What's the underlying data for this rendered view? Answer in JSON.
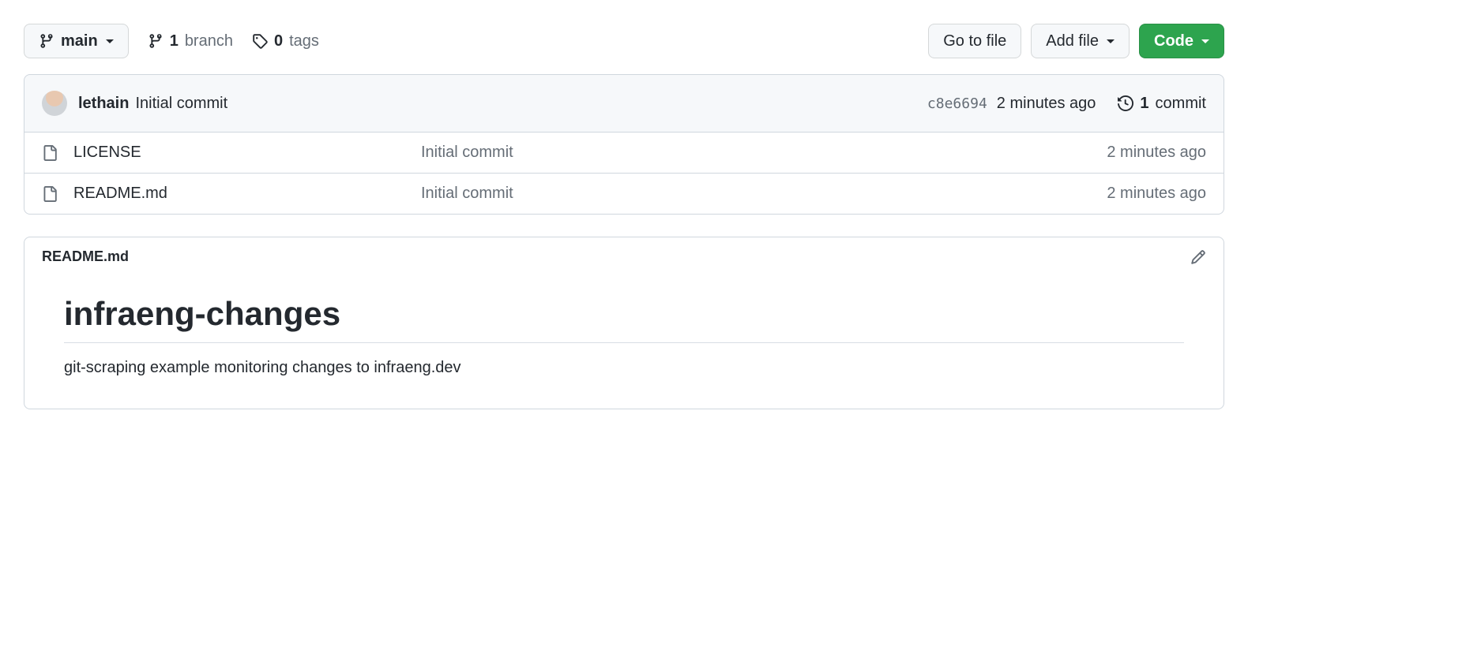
{
  "toolbar": {
    "branch_label": "main",
    "branch_count": "1",
    "branch_word": "branch",
    "tag_count": "0",
    "tag_word": "tags",
    "go_to_file": "Go to file",
    "add_file": "Add file",
    "code": "Code"
  },
  "commit": {
    "author": "lethain",
    "message": "Initial commit",
    "hash": "c8e6694",
    "time": "2 minutes ago",
    "count_num": "1",
    "count_word": "commit"
  },
  "files": [
    {
      "name": "LICENSE",
      "message": "Initial commit",
      "time": "2 minutes ago"
    },
    {
      "name": "README.md",
      "message": "Initial commit",
      "time": "2 minutes ago"
    }
  ],
  "readme": {
    "filename": "README.md",
    "heading": "infraeng-changes",
    "body": "git-scraping example monitoring changes to infraeng.dev"
  }
}
